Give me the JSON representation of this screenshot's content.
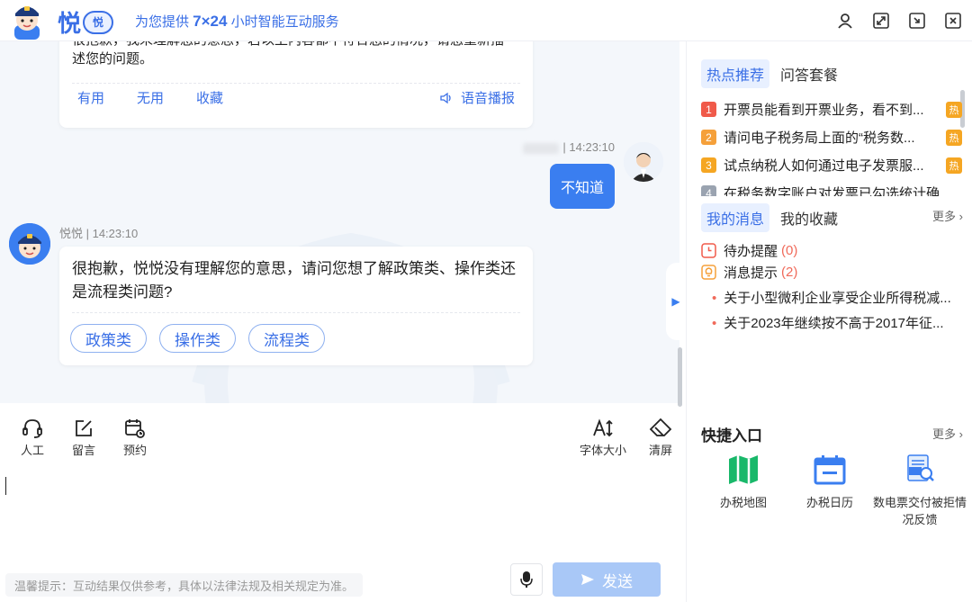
{
  "header": {
    "logo_char": "悦",
    "logo_badge": "悦",
    "slogan_pre": "为您提供 ",
    "slogan_strong": "7×24",
    "slogan_post": " 小时智能互动服务"
  },
  "chat": {
    "bot_msg_1_cut": "很抱歉，我未理解您的意思，若以上内容都不符合您的情况，请您重新描",
    "bot_msg_1_line2": "述您的问题。",
    "actions": [
      "有用",
      "无用",
      "收藏"
    ],
    "speak_label": "语音播报",
    "user_meta": "| 14:23:10",
    "user_msg": "不知道",
    "bot_meta": "悦悦 | 14:23:10",
    "bot_msg_2": "很抱歉，悦悦没有理解您的意思，请问您想了解政策类、操作类还是流程类问题?",
    "options": [
      "政策类",
      "操作类",
      "流程类"
    ]
  },
  "toolbar": {
    "human": "人工",
    "leave_msg": "留言",
    "appointment": "预约",
    "font_size": "字体大小",
    "clear": "清屏"
  },
  "input": {
    "tip": "温馨提示：互动结果仅供参考，具体以法律法规及相关规定为准。",
    "send": "发送"
  },
  "right": {
    "tab_hot": "热点推荐",
    "tab_qa": "问答套餐",
    "hot_tag": "热",
    "hot_items": [
      {
        "num": "1",
        "color": "#f05a4a",
        "text": "开票员能看到开票业务，看不到..."
      },
      {
        "num": "2",
        "color": "#f5a03a",
        "text": "请问电子税务局上面的“税务数..."
      },
      {
        "num": "3",
        "color": "#f5a623",
        "text": "试点纳税人如何通过电子发票服..."
      },
      {
        "num": "4",
        "color": "#9aa3b0",
        "text": "在税务数字账户对发票已勾选统计确..."
      }
    ],
    "tab_msg": "我的消息",
    "tab_fav": "我的收藏",
    "more": "更多",
    "todo_label": "待办提醒",
    "todo_count": "(0)",
    "notice_label": "消息提示",
    "notice_count": "(2)",
    "notices": [
      "关于小型微利企业享受企业所得税减...",
      "关于2023年继续按不高于2017年征..."
    ],
    "quick_title": "快捷入口",
    "quick_more": "更多",
    "quick": [
      "办税地图",
      "办税日历",
      "数电票交付被拒情况反馈"
    ]
  }
}
